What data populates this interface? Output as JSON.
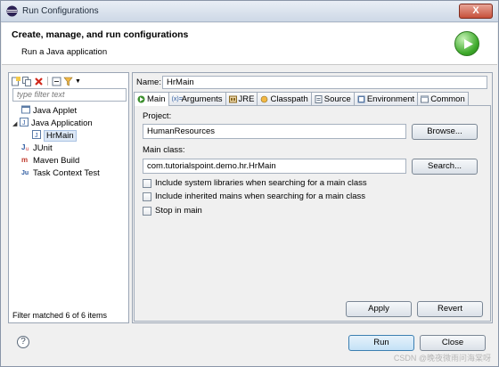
{
  "window": {
    "title": "Run Configurations",
    "close_label": "X"
  },
  "banner": {
    "heading": "Create, manage, and run configurations",
    "subtitle": "Run a Java application"
  },
  "left": {
    "filter_placeholder": "type filter text",
    "tree": [
      {
        "label": "Java Applet",
        "icon": "java-applet-icon",
        "indent": 1
      },
      {
        "label": "Java Application",
        "icon": "java-application-icon",
        "indent": 1,
        "expanded": true
      },
      {
        "label": "HrMain",
        "icon": "java-class-icon",
        "indent": 2,
        "selected": true
      },
      {
        "label": "JUnit",
        "icon": "junit-icon",
        "indent": 1
      },
      {
        "label": "Maven Build",
        "icon": "maven-icon",
        "indent": 1
      },
      {
        "label": "Task Context Test",
        "icon": "task-context-icon",
        "indent": 1
      }
    ],
    "status": "Filter matched 6 of 6 items"
  },
  "right": {
    "name_label": "Name:",
    "name_value": "HrMain",
    "tabs": [
      "Main",
      "Arguments",
      "JRE",
      "Classpath",
      "Source",
      "Environment",
      "Common"
    ],
    "project_label": "Project:",
    "project_value": "HumanResources",
    "browse_label": "Browse...",
    "main_class_label": "Main class:",
    "main_class_value": "com.tutorialspoint.demo.hr.HrMain",
    "search_label": "Search...",
    "checkboxes": [
      "Include system libraries when searching for a main class",
      "Include inherited mains when searching for a main class",
      "Stop in main"
    ],
    "apply_label": "Apply",
    "revert_label": "Revert"
  },
  "footer": {
    "help_label": "?",
    "run_label": "Run",
    "close_label": "Close"
  },
  "watermark": "CSDN @晚夜微雨问海棠呀",
  "colors": {
    "accent_green": "#3da92a",
    "title_bar": "#cdd8e6",
    "selection": "#dde8f6"
  }
}
